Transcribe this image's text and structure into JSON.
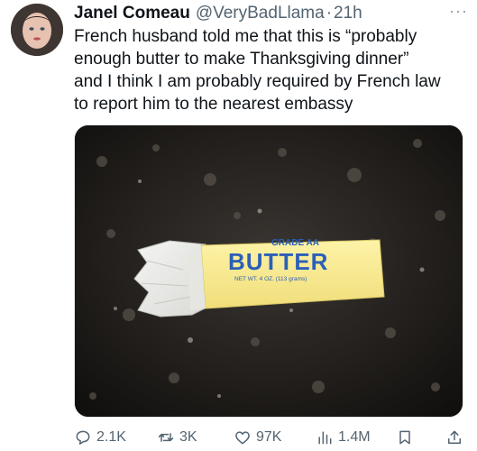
{
  "tweet": {
    "author_name": "Janel Comeau",
    "handle": "@VeryBadLlama",
    "separator": "·",
    "time": "21h",
    "more": "···",
    "lines": [
      "French husband told me that this is “probably",
      "enough butter to make Thanksgiving dinner”",
      "and I think I am probably required by French law",
      "to report him to the nearest embassy"
    ]
  },
  "media": {
    "label_grade": "GRADE AA",
    "label_main": "BUTTER",
    "label_weight": "NET WT. 4 OZ. (113 grams)"
  },
  "actions": {
    "replies": "2.1K",
    "retweets": "3K",
    "likes": "97K",
    "views": "1.4M"
  },
  "icons": [
    "avatar",
    "more-icon",
    "reply-icon",
    "retweet-icon",
    "like-icon",
    "views-icon",
    "bookmark-icon",
    "share-icon"
  ],
  "colors": {
    "text": "#0f1419",
    "muted": "#536471",
    "butter_label": "#2b5fb8"
  }
}
